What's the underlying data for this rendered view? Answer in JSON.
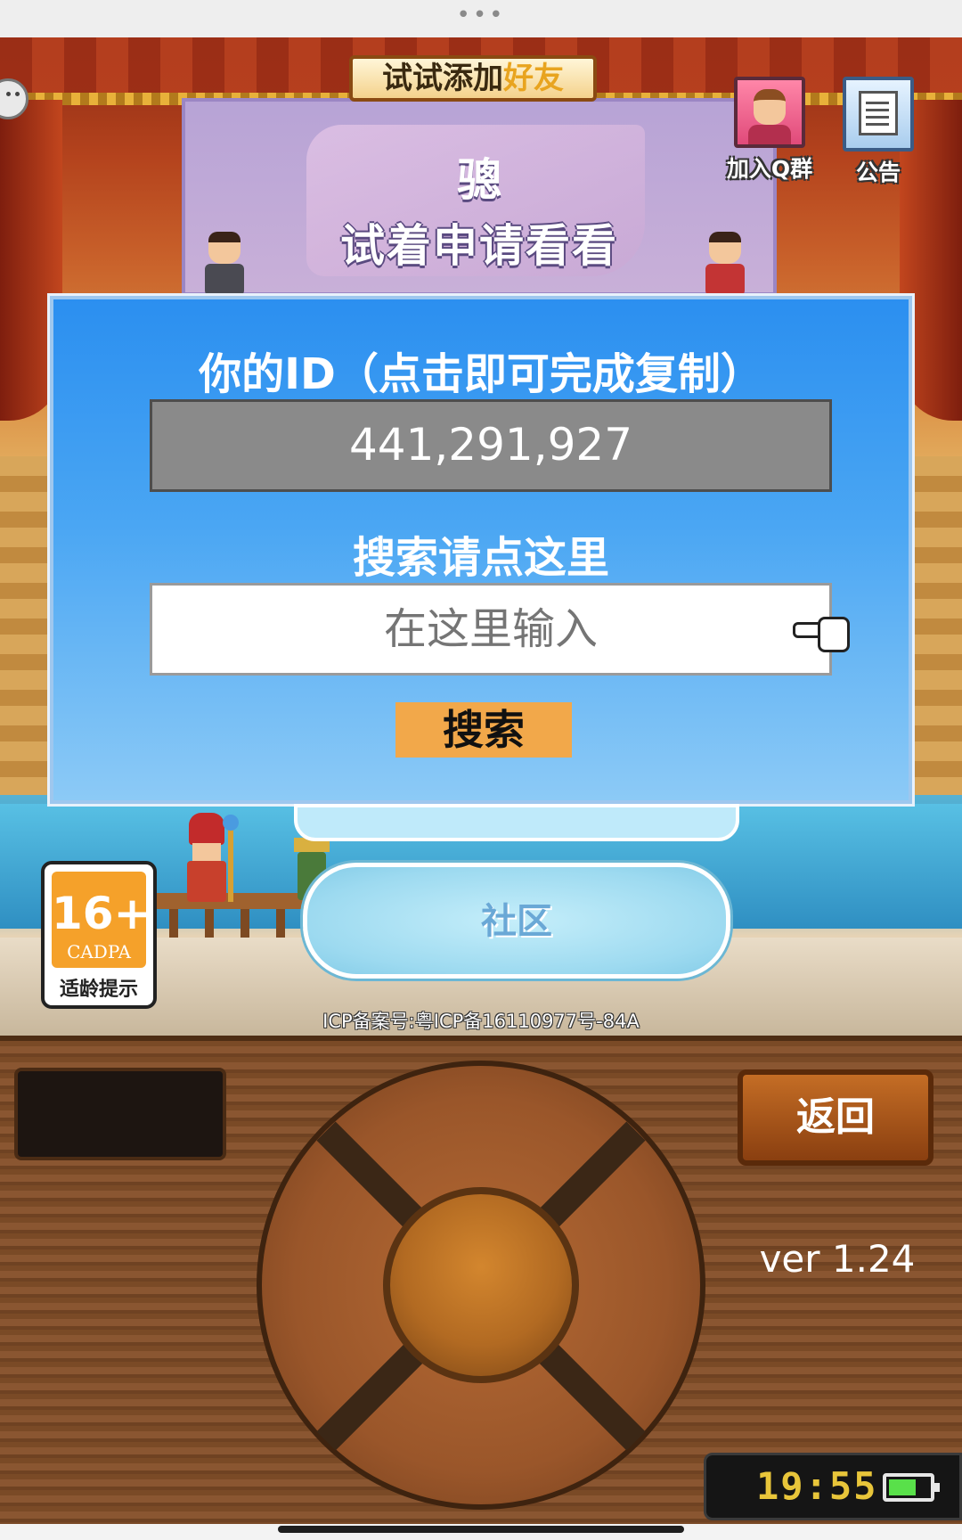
{
  "header": {
    "menu_dots": "•••"
  },
  "friend_banner": {
    "title_prefix": "试试添加",
    "title_highlight": "好友",
    "name": "骢",
    "message": "试着申请看看"
  },
  "top_buttons": {
    "qq_group_label": "加入Q群",
    "notice_label": "公告"
  },
  "dialog": {
    "id_title": "你的ID（点击即可完成复制）",
    "id_value": "441,291,927",
    "search_title": "搜索请点这里",
    "search_placeholder": "在这里输入",
    "search_button": "搜索"
  },
  "community": {
    "label": "社区"
  },
  "age_badge": {
    "rating": "16+",
    "org": "CADPA",
    "tip": "适龄提示"
  },
  "icp": "ICP备案号:粤ICP备16110977号-84A",
  "console": {
    "back_label": "返回",
    "version": "ver 1.24",
    "clock": "19:55"
  },
  "colors": {
    "dialog_blue": "#2b8ff0",
    "search_button": "#f2a84a",
    "battery_fill": "#59e04a",
    "clock_text": "#e8c53a"
  }
}
